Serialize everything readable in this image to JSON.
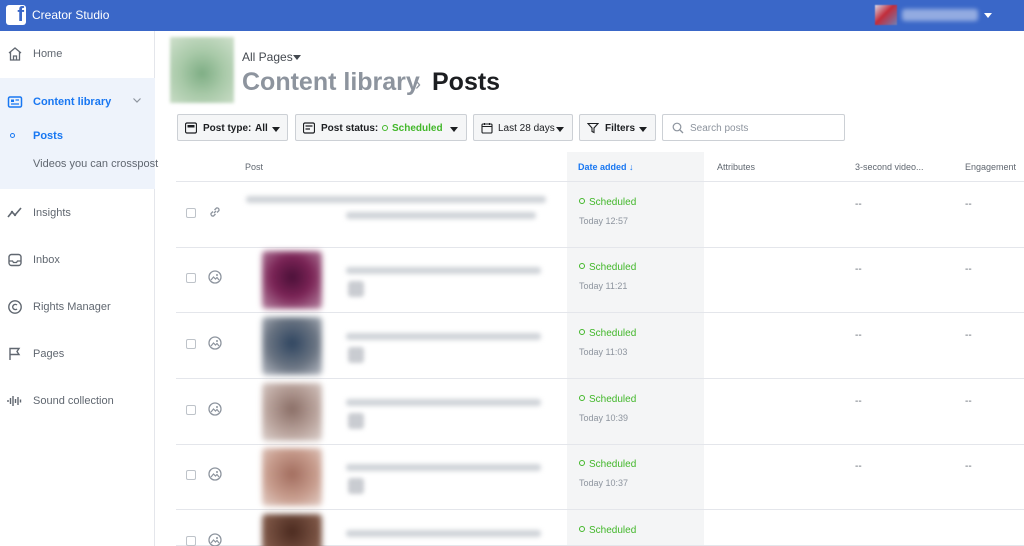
{
  "app": {
    "title": "Creator Studio",
    "logo_glyph": "f"
  },
  "profile": {
    "name_obscured": true
  },
  "sidebar": {
    "items": [
      {
        "label": "Home",
        "icon": "home-icon"
      },
      {
        "label": "Content library",
        "icon": "library-icon",
        "active": true,
        "sub": [
          {
            "label": "Posts",
            "active": true
          },
          {
            "label": "Videos you can crosspost"
          }
        ]
      },
      {
        "label": "Insights",
        "icon": "insights-icon"
      },
      {
        "label": "Inbox",
        "icon": "inbox-icon"
      },
      {
        "label": "Rights Manager",
        "icon": "copyright-icon"
      },
      {
        "label": "Pages",
        "icon": "flag-icon"
      },
      {
        "label": "Sound collection",
        "icon": "waveform-icon"
      }
    ]
  },
  "header": {
    "page_selector": "All Pages",
    "breadcrumb_parent": "Content library",
    "breadcrumb_sep": "›",
    "breadcrumb_current": "Posts"
  },
  "filters": {
    "post_type_label": "Post type:",
    "post_type_value": "All",
    "post_status_label": "Post status:",
    "post_status_value": "Scheduled",
    "date_range": "Last 28 days",
    "filters_label": "Filters",
    "search_placeholder": "Search posts"
  },
  "table": {
    "columns": {
      "post": "Post",
      "date_added": "Date added ↓",
      "attributes": "Attributes",
      "three_sec": "3-second video...",
      "engagement": "Engagement"
    },
    "rows": [
      {
        "type_icon": "link-icon",
        "status": "Scheduled",
        "time": "Today 12:57",
        "three_sec": "--",
        "engagement": "--"
      },
      {
        "type_icon": "photo-icon",
        "status": "Scheduled",
        "time": "Today 11:21",
        "three_sec": "--",
        "engagement": "--"
      },
      {
        "type_icon": "photo-icon",
        "status": "Scheduled",
        "time": "Today 11:03",
        "three_sec": "--",
        "engagement": "--"
      },
      {
        "type_icon": "photo-icon",
        "status": "Scheduled",
        "time": "Today 10:39",
        "three_sec": "--",
        "engagement": "--"
      },
      {
        "type_icon": "photo-icon",
        "status": "Scheduled",
        "time": "Today 10:37",
        "three_sec": "--",
        "engagement": "--"
      },
      {
        "type_icon": "photo-icon",
        "status": "Scheduled",
        "time": "",
        "three_sec": "",
        "engagement": ""
      }
    ]
  },
  "colors": {
    "brand": "#3a67c8",
    "link": "#1877f2",
    "scheduled": "#42b72a"
  }
}
